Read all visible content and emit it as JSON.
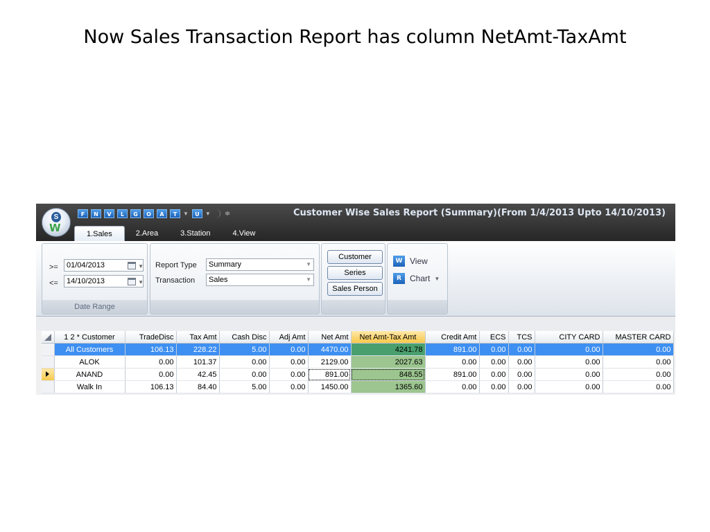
{
  "slide": {
    "title": "Now Sales Transaction Report has column NetAmt-TaxAmt"
  },
  "app": {
    "window_title": "Customer Wise Sales Report (Summary)(From 1/4/2013 Upto 14/10/2013)",
    "orb": {
      "letter": "S",
      "mark": "W"
    },
    "quick_access": [
      {
        "label": "F",
        "icon": "report-f-icon"
      },
      {
        "label": "N",
        "icon": "report-n-icon"
      },
      {
        "label": "V",
        "icon": "report-v-icon"
      },
      {
        "label": "L",
        "icon": "report-l-icon"
      },
      {
        "label": "G",
        "icon": "report-g-icon"
      },
      {
        "label": "O",
        "icon": "report-o-icon"
      },
      {
        "label": "A",
        "icon": "report-a-icon"
      },
      {
        "label": "T",
        "icon": "report-t-icon"
      },
      {
        "label": "U",
        "icon": "report-u-icon"
      }
    ],
    "tabs": [
      {
        "label": "1.Sales",
        "active": true
      },
      {
        "label": "2.Area"
      },
      {
        "label": "3.Station"
      },
      {
        "label": "4.View"
      }
    ]
  },
  "ribbon": {
    "date_range": {
      "label": "Date Range",
      "from_op": ">=",
      "from_value": "01/04/2013",
      "to_op": "<=",
      "to_value": "14/10/2013"
    },
    "report": {
      "report_type_label": "Report Type",
      "report_type_value": "Summary",
      "transaction_label": "Transaction",
      "transaction_value": "Sales"
    },
    "buttons": {
      "customer": "Customer",
      "series": "Series",
      "sales_person": "Sales Person"
    },
    "view": {
      "view_label": "View",
      "view_icon": "W",
      "chart_label": "Chart",
      "chart_icon": "R"
    }
  },
  "grid": {
    "group_headers": {
      "g1": "1",
      "g2": "2",
      "star": "*"
    },
    "columns": [
      "Customer",
      "TradeDisc",
      "Tax Amt",
      "Cash Disc",
      "Adj Amt",
      "Net Amt",
      "Net Amt-Tax Amt",
      "Credit Amt",
      "ECS",
      "TCS",
      "CITY CARD",
      "MASTER CARD"
    ],
    "rows": [
      [
        "All Customers",
        "106.13",
        "228.22",
        "5.00",
        "0.00",
        "4470.00",
        "4241.78",
        "891.00",
        "0.00",
        "0.00",
        "0.00",
        "0.00"
      ],
      [
        "ALOK",
        "0.00",
        "101.37",
        "0.00",
        "0.00",
        "2129.00",
        "2027.63",
        "0.00",
        "0.00",
        "0.00",
        "0.00",
        "0.00"
      ],
      [
        "ANAND",
        "0.00",
        "42.45",
        "0.00",
        "0.00",
        "891.00",
        "848.55",
        "891.00",
        "0.00",
        "0.00",
        "0.00",
        "0.00"
      ],
      [
        "Walk In",
        "106.13",
        "84.40",
        "5.00",
        "0.00",
        "1450.00",
        "1365.60",
        "0.00",
        "0.00",
        "0.00",
        "0.00",
        "0.00"
      ]
    ],
    "selected_row": 0,
    "current_row": 2,
    "highlight_column": 6,
    "colors": {
      "selected": "#3d8ff1",
      "net_tax_col": "#9cc58f",
      "header_highlight": "#f7c84b"
    }
  }
}
